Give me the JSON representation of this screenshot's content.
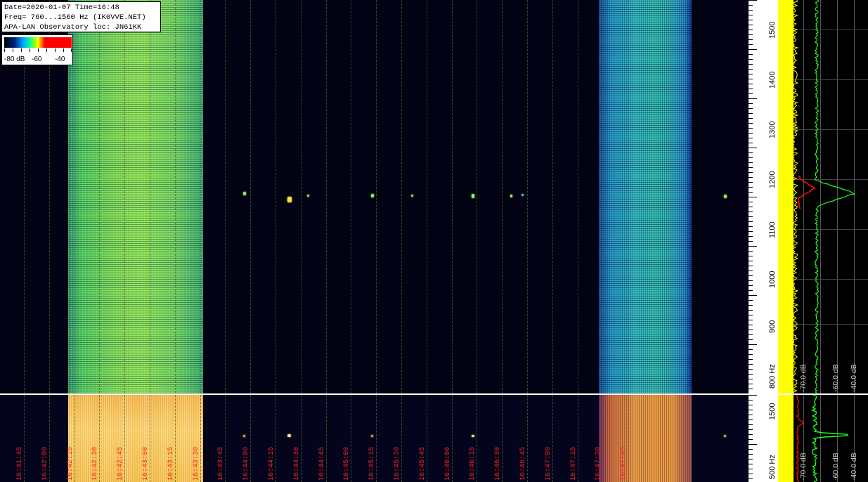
{
  "info": {
    "line1": "Date=2020-01-07 Time=16:48",
    "line2": "Freq= 760...1560 Hz (IK0VVE.NET)",
    "line3": "APA-LAN Observatory loc: JN61KK"
  },
  "legend": {
    "labels": [
      "-80 dB",
      "-60",
      "-40"
    ]
  },
  "freq_axis": {
    "top_labels": [
      "1500",
      "1400",
      "1300",
      "1200",
      "1100",
      "1000",
      "900",
      "800 Hz"
    ],
    "bottom_labels": [
      "1500",
      "500 Hz"
    ]
  },
  "db_axis": {
    "top_labels": [
      "-70.0 dB",
      "-60.0 dB",
      "-40.0 dB"
    ],
    "bottom_labels": [
      "-70.0 dB",
      "-60.0 dB",
      "-40.0 dB"
    ]
  },
  "time_labels": [
    "16:41:45",
    "16:42:00",
    "16:42:15",
    "16:42:30",
    "16:42:45",
    "16:43:00",
    "16:43:15",
    "16:43:30",
    "16:43:45",
    "16:44:00",
    "16:44:15",
    "16:44:30",
    "16:44:45",
    "16:45:00",
    "16:45:15",
    "16:45:30",
    "16:45:45",
    "16:46:00",
    "16:46:15",
    "16:46:30",
    "16:46:45",
    "16:47:00",
    "16:47:15",
    "16:47:30",
    "16:47:45"
  ],
  "colors": {
    "background": "#020214",
    "band_green": "#4fd06a",
    "band_cyan": "#3ac6c0",
    "band_gold": "#f2b640",
    "spectrum_yellow": "#ffff00",
    "spectrum_green": "#20ff20",
    "spectrum_red": "#ff1010",
    "time_label": "#ff2020"
  }
}
